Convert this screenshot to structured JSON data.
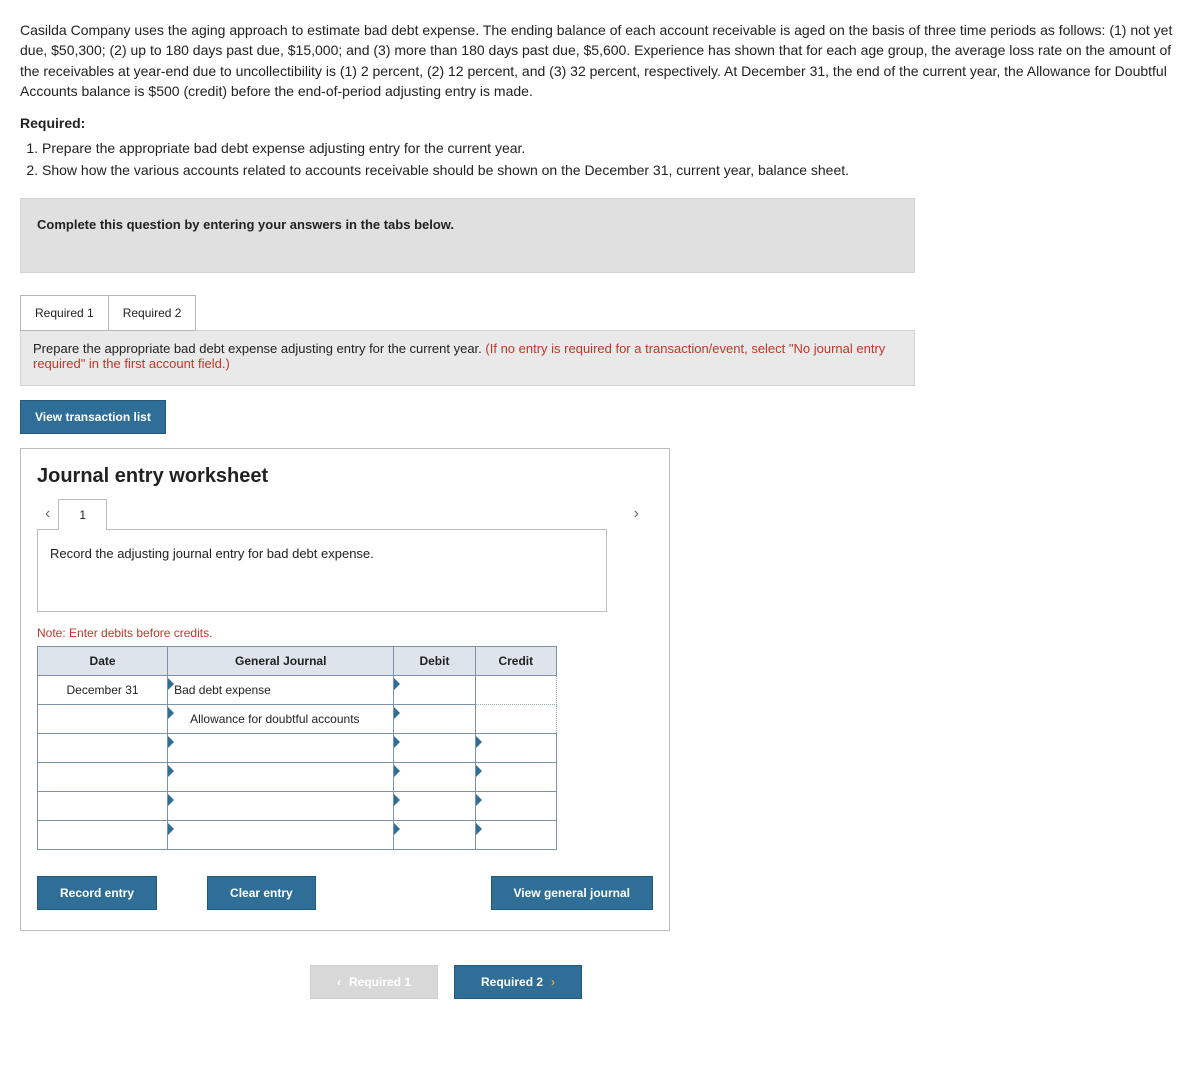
{
  "problem": {
    "text": "Casilda Company uses the aging approach to estimate bad debt expense. The ending balance of each account receivable is aged on the basis of three time periods as follows: (1) not yet due, $50,300; (2) up to 180 days past due, $15,000; and (3) more than 180 days past due, $5,600. Experience has shown that for each age group, the average loss rate on the amount of the receivables at year-end due to uncollectibility is (1) 2 percent, (2) 12 percent, and (3) 32 percent, respectively. At December 31, the end of the current year, the Allowance for Doubtful Accounts balance is $500 (credit) before the end-of-period adjusting entry is made."
  },
  "required_label": "Required:",
  "required_items": [
    "Prepare the appropriate bad debt expense adjusting entry for the current year.",
    "Show how the various accounts related to accounts receivable should be shown on the December 31, current year, balance sheet."
  ],
  "instruction_box": "Complete this question by entering your answers in the tabs below.",
  "tabs": {
    "tab1": "Required 1",
    "tab2": "Required 2"
  },
  "panel": {
    "black": "Prepare the appropriate bad debt expense adjusting entry for the current year. ",
    "red": "(If no entry is required for a transaction/event, select \"No journal entry required\" in the first account field.)"
  },
  "view_trans": "View transaction list",
  "worksheet": {
    "title": "Journal entry worksheet",
    "entry_num": "1",
    "instr": "Record the adjusting journal entry for bad debt expense.",
    "note": "Note: Enter debits before credits.",
    "headers": {
      "date": "Date",
      "gj": "General Journal",
      "debit": "Debit",
      "credit": "Credit"
    },
    "rows": [
      {
        "date": "December 31",
        "gj": "Bad debt expense",
        "debit": "",
        "credit": ""
      },
      {
        "date": "",
        "gj": "Allowance for doubtful accounts",
        "debit": "",
        "credit": ""
      },
      {
        "date": "",
        "gj": "",
        "debit": "",
        "credit": ""
      },
      {
        "date": "",
        "gj": "",
        "debit": "",
        "credit": ""
      },
      {
        "date": "",
        "gj": "",
        "debit": "",
        "credit": ""
      },
      {
        "date": "",
        "gj": "",
        "debit": "",
        "credit": ""
      }
    ],
    "buttons": {
      "record": "Record entry",
      "clear": "Clear entry",
      "view": "View general journal"
    }
  },
  "bottom_nav": {
    "prev": "Required 1",
    "next": "Required 2"
  }
}
